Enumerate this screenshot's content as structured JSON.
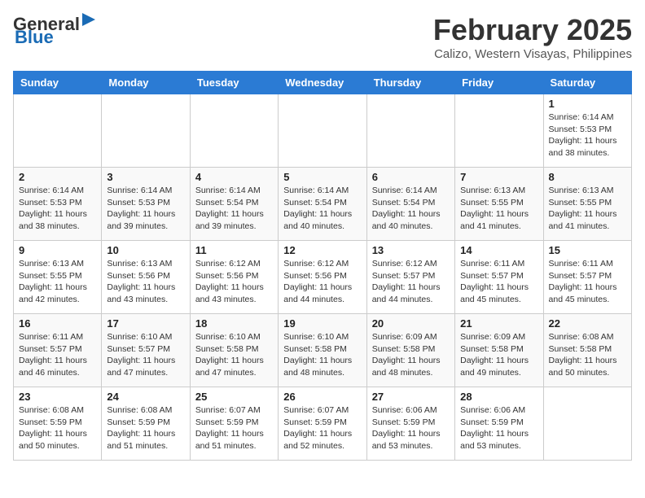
{
  "header": {
    "logo_general": "General",
    "logo_blue": "Blue",
    "month_title": "February 2025",
    "location": "Calizo, Western Visayas, Philippines"
  },
  "calendar": {
    "days_of_week": [
      "Sunday",
      "Monday",
      "Tuesday",
      "Wednesday",
      "Thursday",
      "Friday",
      "Saturday"
    ],
    "weeks": [
      [
        {
          "day": "",
          "info": ""
        },
        {
          "day": "",
          "info": ""
        },
        {
          "day": "",
          "info": ""
        },
        {
          "day": "",
          "info": ""
        },
        {
          "day": "",
          "info": ""
        },
        {
          "day": "",
          "info": ""
        },
        {
          "day": "1",
          "info": "Sunrise: 6:14 AM\nSunset: 5:53 PM\nDaylight: 11 hours\nand 38 minutes."
        }
      ],
      [
        {
          "day": "2",
          "info": "Sunrise: 6:14 AM\nSunset: 5:53 PM\nDaylight: 11 hours\nand 38 minutes."
        },
        {
          "day": "3",
          "info": "Sunrise: 6:14 AM\nSunset: 5:53 PM\nDaylight: 11 hours\nand 39 minutes."
        },
        {
          "day": "4",
          "info": "Sunrise: 6:14 AM\nSunset: 5:54 PM\nDaylight: 11 hours\nand 39 minutes."
        },
        {
          "day": "5",
          "info": "Sunrise: 6:14 AM\nSunset: 5:54 PM\nDaylight: 11 hours\nand 40 minutes."
        },
        {
          "day": "6",
          "info": "Sunrise: 6:14 AM\nSunset: 5:54 PM\nDaylight: 11 hours\nand 40 minutes."
        },
        {
          "day": "7",
          "info": "Sunrise: 6:13 AM\nSunset: 5:55 PM\nDaylight: 11 hours\nand 41 minutes."
        },
        {
          "day": "8",
          "info": "Sunrise: 6:13 AM\nSunset: 5:55 PM\nDaylight: 11 hours\nand 41 minutes."
        }
      ],
      [
        {
          "day": "9",
          "info": "Sunrise: 6:13 AM\nSunset: 5:55 PM\nDaylight: 11 hours\nand 42 minutes."
        },
        {
          "day": "10",
          "info": "Sunrise: 6:13 AM\nSunset: 5:56 PM\nDaylight: 11 hours\nand 43 minutes."
        },
        {
          "day": "11",
          "info": "Sunrise: 6:12 AM\nSunset: 5:56 PM\nDaylight: 11 hours\nand 43 minutes."
        },
        {
          "day": "12",
          "info": "Sunrise: 6:12 AM\nSunset: 5:56 PM\nDaylight: 11 hours\nand 44 minutes."
        },
        {
          "day": "13",
          "info": "Sunrise: 6:12 AM\nSunset: 5:57 PM\nDaylight: 11 hours\nand 44 minutes."
        },
        {
          "day": "14",
          "info": "Sunrise: 6:11 AM\nSunset: 5:57 PM\nDaylight: 11 hours\nand 45 minutes."
        },
        {
          "day": "15",
          "info": "Sunrise: 6:11 AM\nSunset: 5:57 PM\nDaylight: 11 hours\nand 45 minutes."
        }
      ],
      [
        {
          "day": "16",
          "info": "Sunrise: 6:11 AM\nSunset: 5:57 PM\nDaylight: 11 hours\nand 46 minutes."
        },
        {
          "day": "17",
          "info": "Sunrise: 6:10 AM\nSunset: 5:57 PM\nDaylight: 11 hours\nand 47 minutes."
        },
        {
          "day": "18",
          "info": "Sunrise: 6:10 AM\nSunset: 5:58 PM\nDaylight: 11 hours\nand 47 minutes."
        },
        {
          "day": "19",
          "info": "Sunrise: 6:10 AM\nSunset: 5:58 PM\nDaylight: 11 hours\nand 48 minutes."
        },
        {
          "day": "20",
          "info": "Sunrise: 6:09 AM\nSunset: 5:58 PM\nDaylight: 11 hours\nand 48 minutes."
        },
        {
          "day": "21",
          "info": "Sunrise: 6:09 AM\nSunset: 5:58 PM\nDaylight: 11 hours\nand 49 minutes."
        },
        {
          "day": "22",
          "info": "Sunrise: 6:08 AM\nSunset: 5:58 PM\nDaylight: 11 hours\nand 50 minutes."
        }
      ],
      [
        {
          "day": "23",
          "info": "Sunrise: 6:08 AM\nSunset: 5:59 PM\nDaylight: 11 hours\nand 50 minutes."
        },
        {
          "day": "24",
          "info": "Sunrise: 6:08 AM\nSunset: 5:59 PM\nDaylight: 11 hours\nand 51 minutes."
        },
        {
          "day": "25",
          "info": "Sunrise: 6:07 AM\nSunset: 5:59 PM\nDaylight: 11 hours\nand 51 minutes."
        },
        {
          "day": "26",
          "info": "Sunrise: 6:07 AM\nSunset: 5:59 PM\nDaylight: 11 hours\nand 52 minutes."
        },
        {
          "day": "27",
          "info": "Sunrise: 6:06 AM\nSunset: 5:59 PM\nDaylight: 11 hours\nand 53 minutes."
        },
        {
          "day": "28",
          "info": "Sunrise: 6:06 AM\nSunset: 5:59 PM\nDaylight: 11 hours\nand 53 minutes."
        },
        {
          "day": "",
          "info": ""
        }
      ]
    ]
  }
}
